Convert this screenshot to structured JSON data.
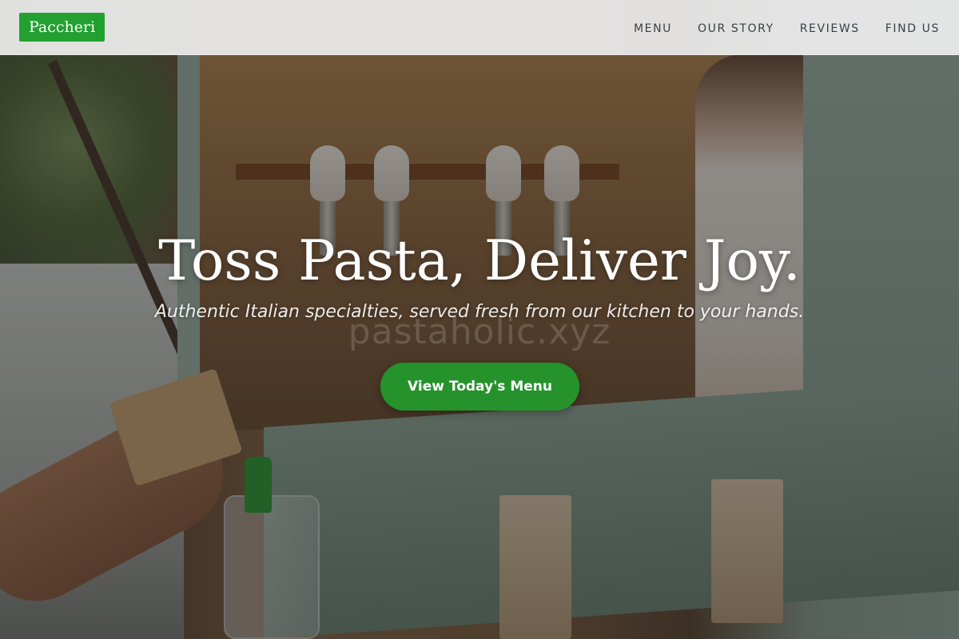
{
  "brand": {
    "name": "Paccheri",
    "color": "#22a030"
  },
  "nav": {
    "items": [
      {
        "label": "MENU"
      },
      {
        "label": "OUR STORY"
      },
      {
        "label": "REVIEWS"
      },
      {
        "label": "FIND US"
      }
    ]
  },
  "hero": {
    "headline": "Toss Pasta, Deliver Joy.",
    "tagline": "Authentic Italian specialties, served fresh from our kitchen to your hands.",
    "watermark": "pastaholic.xyz",
    "cta_label": "View Today's Menu",
    "cta_color": "#25922c",
    "background_image": "food-truck-serving-window-photo"
  }
}
